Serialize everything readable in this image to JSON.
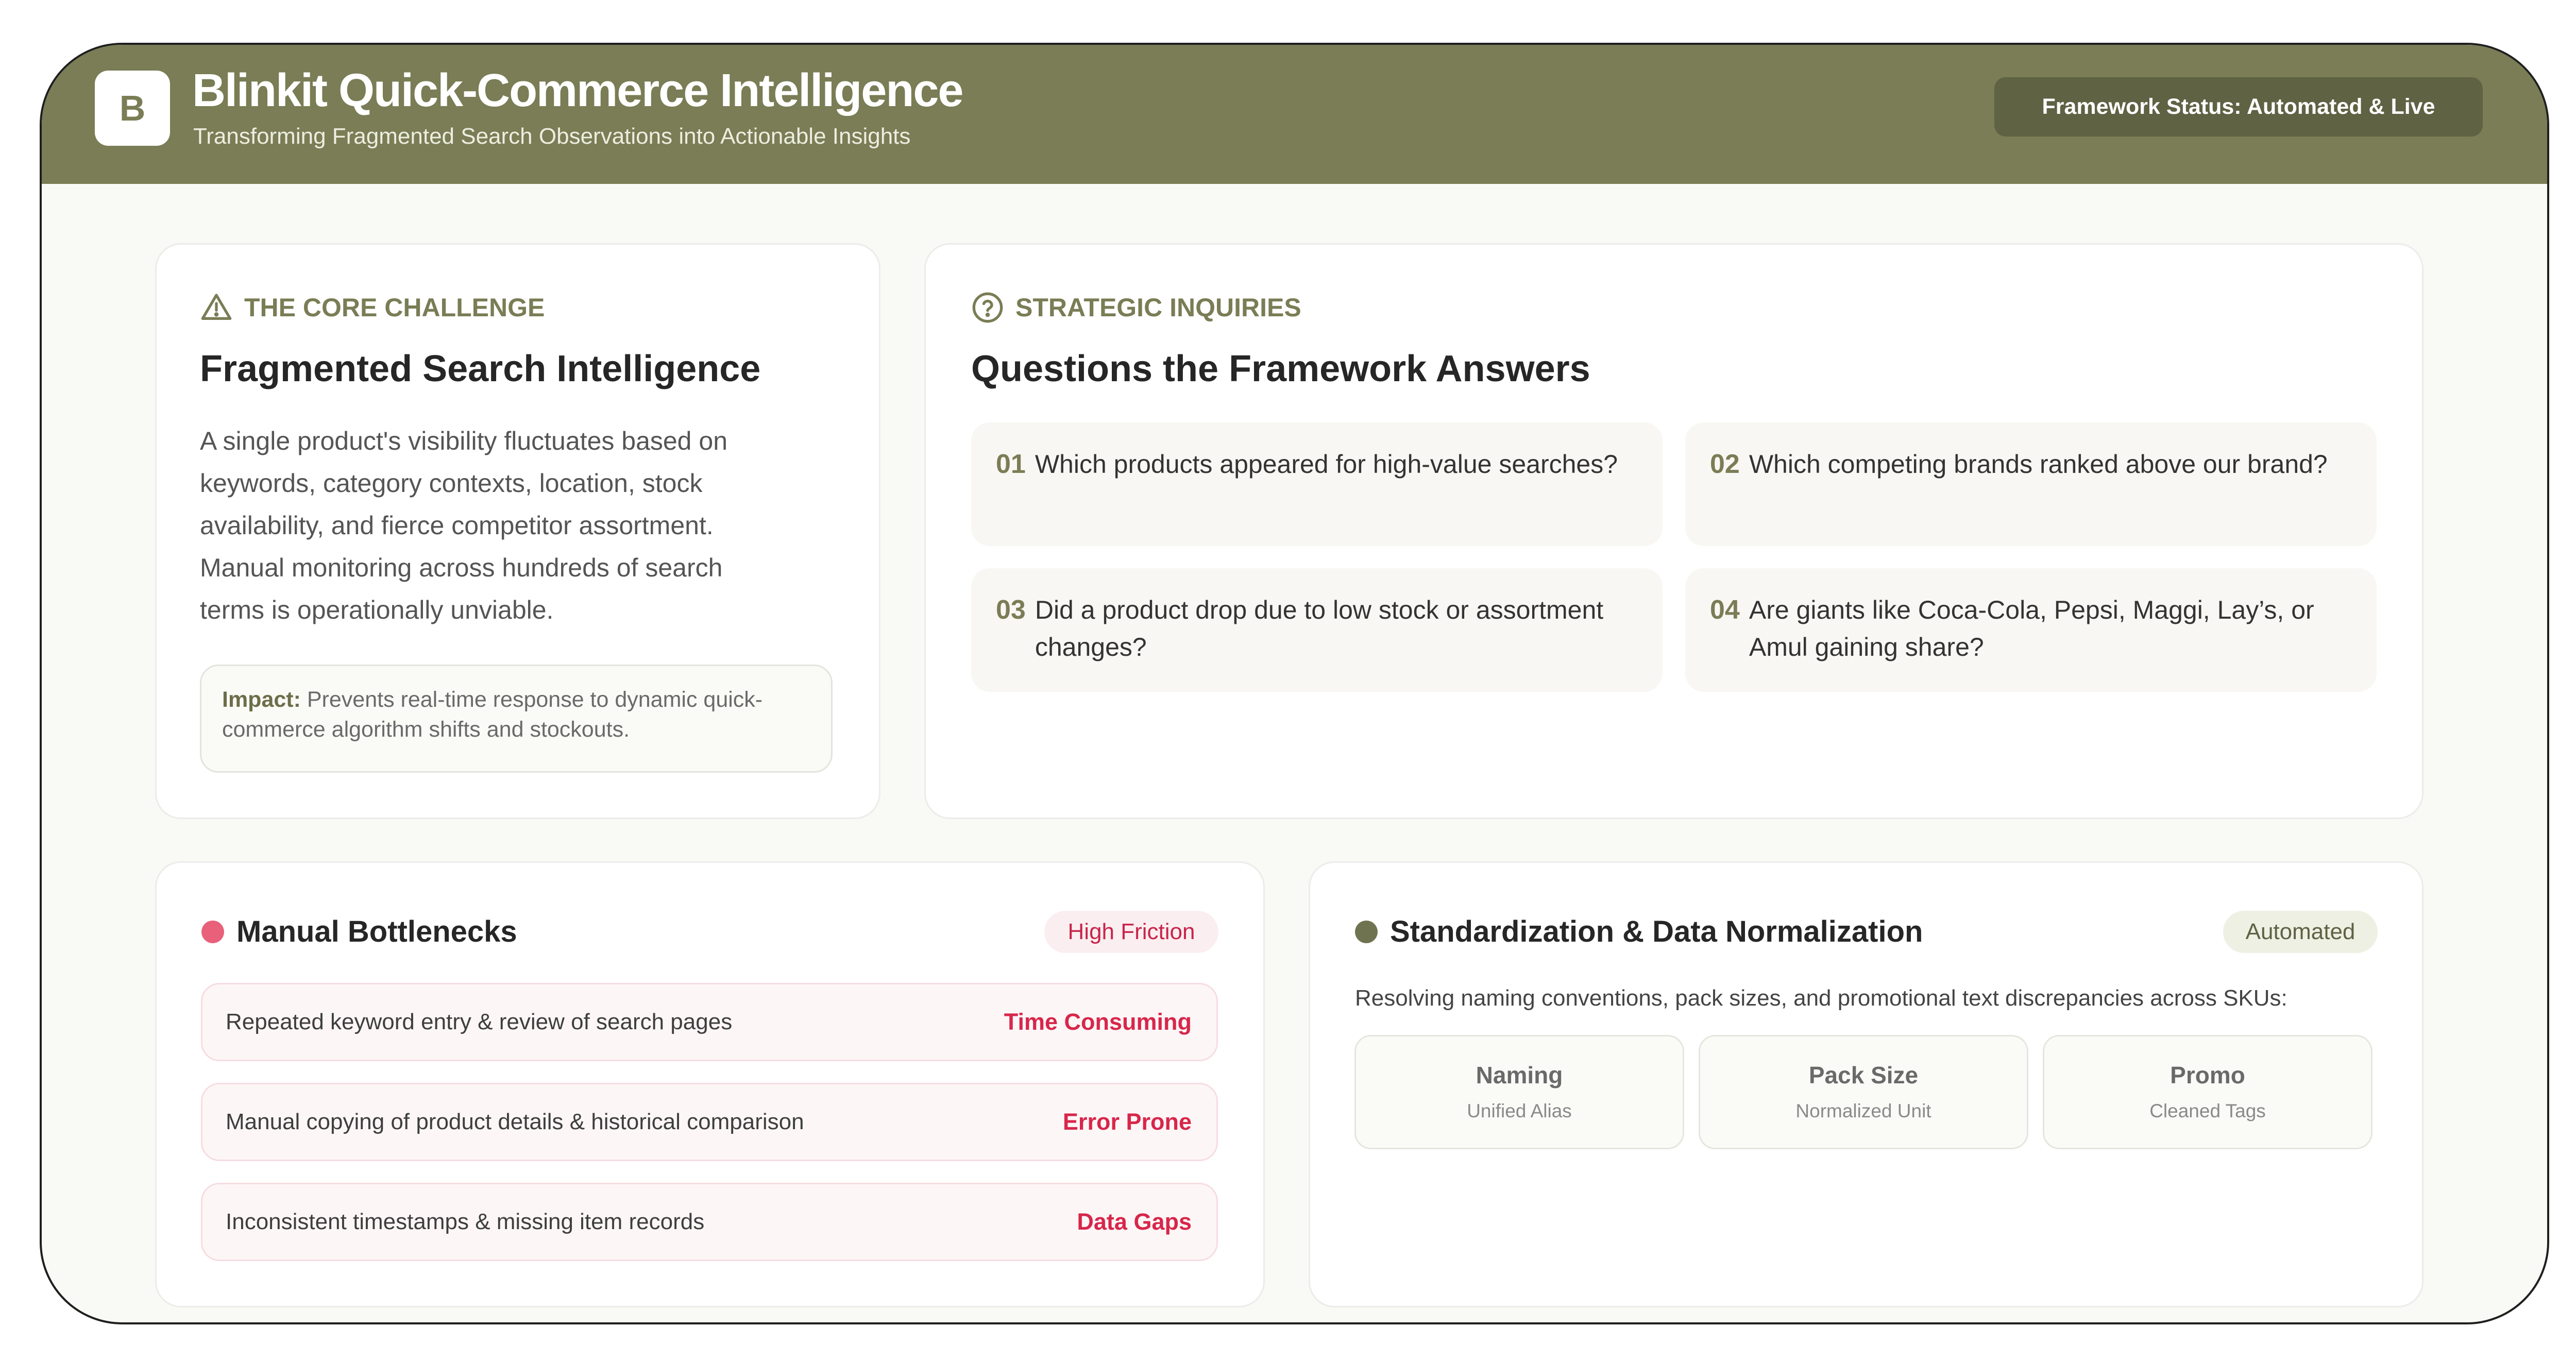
{
  "header": {
    "logo_letter": "B",
    "title": "Blinkit Quick-Commerce Intelligence",
    "subtitle": "Transforming Fragmented Search Observations into Actionable Insights",
    "status": "Framework Status: Automated & Live"
  },
  "challenge": {
    "eyebrow": "THE CORE CHALLENGE",
    "icon": "warning-triangle-icon",
    "title": "Fragmented Search Intelligence",
    "lines": [
      "A single product's visibility fluctuates based on",
      "keywords, category contexts, location, stock",
      "availability, and fierce competitor assortment.",
      "Manual monitoring across hundreds of search",
      "terms is operationally unviable."
    ],
    "impact_label": "Impact:",
    "impact_text": "Prevents real-time response to dynamic quick-commerce algorithm shifts and stockouts."
  },
  "inquiries": {
    "eyebrow": "STRATEGIC INQUIRIES",
    "icon": "question-circle-icon",
    "title": "Questions the Framework Answers",
    "items": [
      {
        "num": "01",
        "text": "Which products appeared for high-value searches?"
      },
      {
        "num": "02",
        "text": "Which competing brands ranked above our brand?"
      },
      {
        "num": "03",
        "text": "Did a product drop due to low stock or assortment changes?"
      },
      {
        "num": "04",
        "text": "Are giants like Coca-Cola, Pepsi, Maggi, Lay’s, or Amul gaining share?"
      }
    ]
  },
  "bottlenecks": {
    "title": "Manual Bottlenecks",
    "tag": "High Friction",
    "dot_color": "#e8607a",
    "rows": [
      {
        "text": "Repeated keyword entry & review of search pages",
        "tag": "Time Consuming"
      },
      {
        "text": "Manual copying of product details & historical comparison",
        "tag": "Error Prone"
      },
      {
        "text": "Inconsistent timestamps & missing item records",
        "tag": "Data Gaps"
      }
    ]
  },
  "normalization": {
    "title": "Standardization & Data Normalization",
    "tag": "Automated",
    "dot_color": "#6f7350",
    "description": "Resolving naming conventions, pack sizes, and promotional text discrepancies across SKUs:",
    "boxes": [
      {
        "label": "Naming",
        "sub": "Unified Alias"
      },
      {
        "label": "Pack Size",
        "sub": "Normalized Unit"
      },
      {
        "label": "Promo",
        "sub": "Cleaned Tags"
      }
    ]
  },
  "colors": {
    "header_bg": "#7a7d55",
    "accent": "#7a7d55",
    "danger": "#d8264a",
    "page_bg": "#f9faf5"
  }
}
